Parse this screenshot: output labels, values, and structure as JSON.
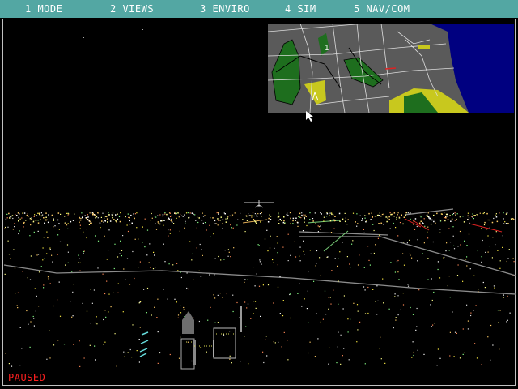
{
  "menu": {
    "items": [
      {
        "label": "1 MODE"
      },
      {
        "label": "2 VIEWS"
      },
      {
        "label": "3 ENVIRO"
      },
      {
        "label": "4 SIM"
      },
      {
        "label": "5 NAV/COM"
      }
    ]
  },
  "status": {
    "paused": "PAUSED"
  },
  "colors": {
    "menubar": "#53a7a3",
    "sky": "#000000",
    "map_land": "#5a5a5a",
    "map_water": "#000080",
    "map_park": "#1e6e1e",
    "map_urban": "#c8c81e",
    "paused_text": "#ff2020"
  },
  "icons": {
    "cursor": "arrow-pointer-icon",
    "aircraft": "aircraft-icon"
  }
}
